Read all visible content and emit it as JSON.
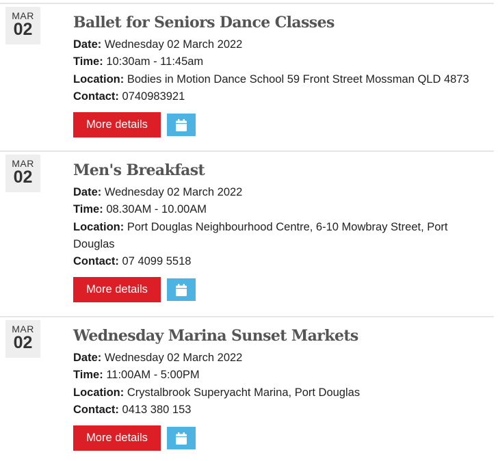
{
  "events": [
    {
      "month": "MAR",
      "day": "02",
      "title": "Ballet for Seniors Dance Classes",
      "date_label": "Date:",
      "date_value": "Wednesday 02 March 2022",
      "time_label": "Time:",
      "time_value": "10:30am - 11:45am",
      "location_label": "Location:",
      "location_value": "Bodies in Motion Dance School 59 Front Street Mossman QLD 4873",
      "contact_label": "Contact:",
      "contact_value": "0740983921",
      "more_label": "More details",
      "calendar_icon": "calendar-icon"
    },
    {
      "month": "MAR",
      "day": "02",
      "title": "Men's Breakfast",
      "date_label": "Date:",
      "date_value": "Wednesday 02 March 2022",
      "time_label": "Time:",
      "time_value": "08.30AM - 10.00AM",
      "location_label": "Location:",
      "location_value": "Port Douglas Neighbourhood Centre, 6-10 Mowbray Street, Port Douglas",
      "contact_label": "Contact:",
      "contact_value": "07 4099 5518",
      "more_label": "More details",
      "calendar_icon": "calendar-icon"
    },
    {
      "month": "MAR",
      "day": "02",
      "title": "Wednesday Marina Sunset Markets",
      "date_label": "Date:",
      "date_value": "Wednesday 02 March 2022",
      "time_label": "Time:",
      "time_value": "11:00AM - 5:00PM",
      "location_label": "Location:",
      "location_value": "Crystalbrook Superyacht Marina, Port Douglas",
      "contact_label": "Contact:",
      "contact_value": "0413 380 153",
      "more_label": "More details",
      "calendar_icon": "calendar-icon"
    }
  ],
  "colors": {
    "more_button": "#dc1f27",
    "calendar_button": "#4cb3e2",
    "date_box": "#eeeeee",
    "title": "#555555"
  }
}
